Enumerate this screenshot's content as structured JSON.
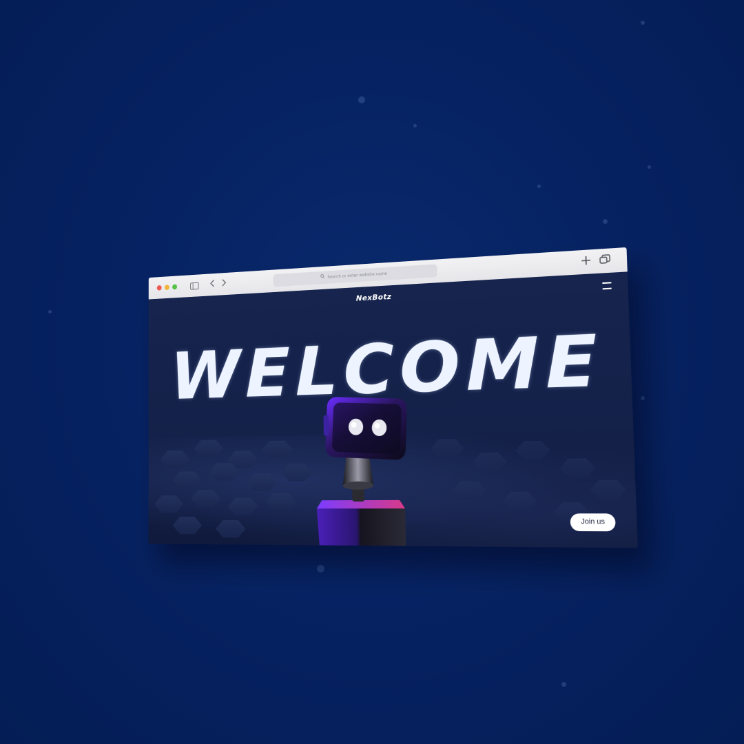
{
  "browser": {
    "address_placeholder": "Search or enter website name",
    "icons": {
      "sidebar": "sidebar-icon",
      "back": "chevron-left-icon",
      "forward": "chevron-right-icon",
      "new_tab": "plus-icon",
      "tabs": "tabs-overview-icon",
      "search": "magnifier-icon"
    },
    "traffic_lights": [
      "#ee5a52",
      "#f0b43a",
      "#55c146"
    ]
  },
  "site": {
    "brand": "NexBotz",
    "hero_title": "WELCOME",
    "cta_label": "Join us",
    "menu_icon": "hamburger-menu-icon",
    "colors": {
      "background": "#062262",
      "page": "#16244e",
      "hero_text": "#eef4ff",
      "robot_accent": "#6a2cff"
    }
  }
}
